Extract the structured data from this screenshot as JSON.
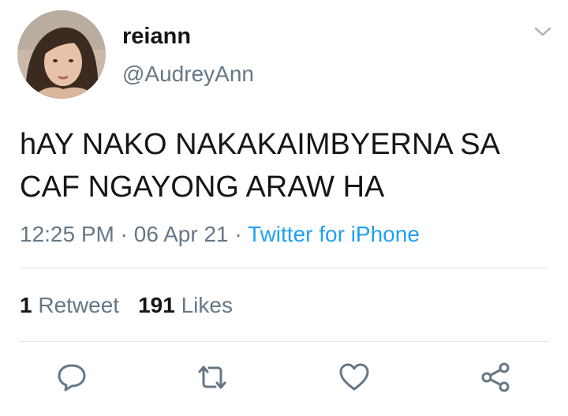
{
  "tweet": {
    "user": {
      "display_name": "reiann",
      "handle": "@AudreyAnn"
    },
    "text_line1": "hAY NAKO NAKAKAIMBYERNA SA",
    "text_line2": "CAF NGAYONG ARAW HA",
    "time": "12:25 PM",
    "separator": "·",
    "date": "06 Apr 21",
    "source": "Twitter for iPhone",
    "retweet_count": "1",
    "retweet_label": "Retweet",
    "like_count": "191",
    "like_label": "Likes"
  },
  "icons": {
    "menu": "chevron-down-icon",
    "reply": "reply-icon",
    "retweet": "retweet-icon",
    "like": "heart-icon",
    "share": "share-icon"
  },
  "colors": {
    "text": "#14171a",
    "secondary": "#657786",
    "link": "#1da1f2",
    "divider": "#e1e8ed"
  }
}
